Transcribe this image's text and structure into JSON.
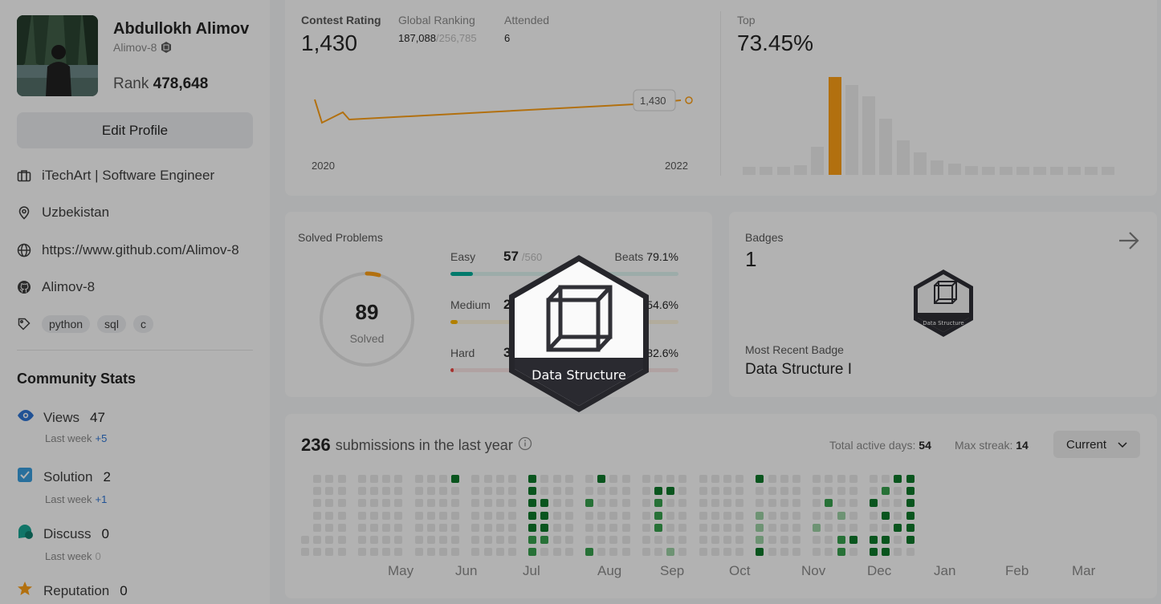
{
  "profile": {
    "name": "Abdullokh Alimov",
    "username": "Alimov-8",
    "rank_label": "Rank",
    "rank_value": "478,648",
    "edit_label": "Edit Profile",
    "company": "iTechArt | Software Engineer",
    "location": "Uzbekistan",
    "website": "https://www.github.com/Alimov-8",
    "github": "Alimov-8",
    "skills": [
      "python",
      "sql",
      "c"
    ]
  },
  "community": {
    "title": "Community Stats",
    "stats": [
      {
        "label": "Views",
        "value": "47",
        "sub": "Last week",
        "delta": "+5",
        "icon": "eye-icon"
      },
      {
        "label": "Solution",
        "value": "2",
        "sub": "Last week",
        "delta": "+1",
        "icon": "check-square-icon"
      },
      {
        "label": "Discuss",
        "value": "0",
        "sub": "Last week",
        "delta": "0",
        "icon": "chat-icon"
      },
      {
        "label": "Reputation",
        "value": "0",
        "icon": "star-icon"
      }
    ]
  },
  "contest": {
    "rating_label": "Contest Rating",
    "rating_value": "1,430",
    "global_label": "Global Ranking",
    "global_value": "187,088",
    "global_total": "/256,785",
    "attended_label": "Attended",
    "attended_value": "6",
    "tooltip": "1,430",
    "x_start": "2020",
    "x_end": "2022",
    "top_label": "Top",
    "top_value": "73.45%"
  },
  "solved": {
    "title": "Solved Problems",
    "count": "89",
    "count_label": "Solved",
    "rows": [
      {
        "name": "Easy",
        "count": "57",
        "total": "/560",
        "beats_label": "Beats",
        "beats": "79.1%",
        "color": "#00af9b",
        "track": "#e0f6f3",
        "fraction": 0.1
      },
      {
        "name": "Medium",
        "count": "2",
        "total": "",
        "beats_label": "",
        "beats": "54.6%",
        "color": "#ffb800",
        "track": "#fff7e0",
        "fraction": 0.03
      },
      {
        "name": "Hard",
        "count": "3",
        "total": "",
        "beats_label": "",
        "beats": "82.6%",
        "color": "#ef4743",
        "track": "#fde8e8",
        "fraction": 0.01
      }
    ]
  },
  "badges": {
    "title": "Badges",
    "count": "1",
    "recent_label": "Most Recent Badge",
    "recent_name": "Data Structure I",
    "badge_text": "Data Structure"
  },
  "submissions": {
    "count": "236",
    "title": "submissions in the last year",
    "active_label": "Total active days:",
    "active_value": "54",
    "streak_label": "Max streak:",
    "streak_value": "14",
    "current_label": "Current",
    "months": [
      "May",
      "Jun",
      "Jul",
      "Aug",
      "Sep",
      "Oct",
      "Nov",
      "Dec",
      "Jan",
      "Feb",
      "Mar"
    ]
  }
}
